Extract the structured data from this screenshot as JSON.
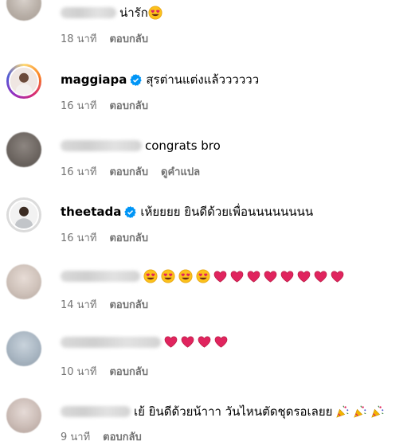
{
  "comments": [
    {
      "username": "",
      "text": "น่ารัก",
      "emojis": [
        "heart-eyes"
      ],
      "time": "18 นาที",
      "reply": "ตอบกลับ",
      "translate": ""
    },
    {
      "username": "maggiapa",
      "text": "สุรต่านแต่งแล้วววววว",
      "emojis": [],
      "time": "16 นาที",
      "reply": "ตอบกลับ",
      "translate": ""
    },
    {
      "username": "",
      "text": "congrats bro",
      "emojis": [],
      "time": "16 นาที",
      "reply": "ตอบกลับ",
      "translate": "ดูคำแปล"
    },
    {
      "username": "theetada",
      "text": "เห้ยยยย ยินดีด้วยเพื่อนนนนนนนน",
      "emojis": [],
      "time": "16 นาที",
      "reply": "ตอบกลับ",
      "translate": ""
    },
    {
      "username": "",
      "text": "",
      "emojis": [
        "heart-eyes",
        "heart-eyes",
        "heart-eyes",
        "heart-eyes",
        "red-heart",
        "red-heart",
        "red-heart",
        "red-heart",
        "red-heart",
        "red-heart",
        "red-heart",
        "red-heart"
      ],
      "time": "14 นาที",
      "reply": "ตอบกลับ",
      "translate": ""
    },
    {
      "username": "",
      "text": "",
      "emojis": [
        "red-heart",
        "red-heart",
        "red-heart",
        "red-heart"
      ],
      "time": "10 นาที",
      "reply": "ตอบกลับ",
      "translate": ""
    },
    {
      "username": "",
      "text": "เย้ ยินดีด้วยน้าาา วันไหนตัดชุดรอเลยย",
      "emojis": [
        "party-popper",
        "party-popper",
        "party-popper"
      ],
      "time": "9 นาที",
      "reply": "ตอบกลับ",
      "translate": ""
    }
  ],
  "colors": {
    "meta": "#737373",
    "verified": "#0095f6",
    "heart": "#e0245e"
  }
}
